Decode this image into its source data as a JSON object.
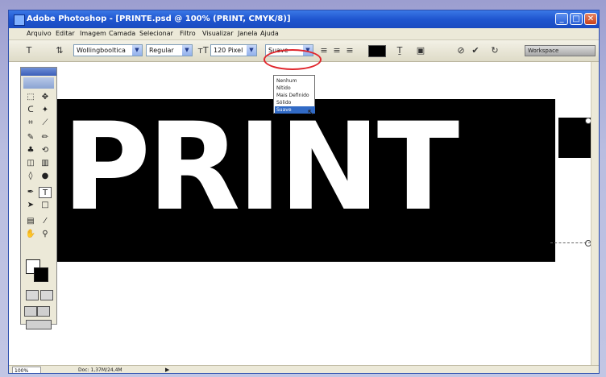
{
  "window": {
    "title": "Adobe Photoshop - [PRINTE.psd @ 100% (PRINT, CMYK/8)]",
    "minimize_glyph": "_",
    "maximize_glyph": "□",
    "close_glyph": "✕"
  },
  "menubar": {
    "items": [
      "Arquivo",
      "Editar",
      "Imagem",
      "Camada",
      "Selecionar",
      "Filtro",
      "Visualizar",
      "Janela",
      "Ajuda"
    ]
  },
  "options_bar": {
    "font_family": "Wollingbooltica",
    "font_style": "Regular",
    "font_size": "120 Pixel",
    "antialias": "Suave",
    "color_hex": "#000000",
    "workspace": "Workspace"
  },
  "antialias_dropdown": {
    "options": [
      "Nenhum",
      "Nítido",
      "Mais Definido",
      "Sólido",
      "Suave"
    ],
    "selected_index": 4
  },
  "canvas": {
    "text": "PRINT",
    "banner_color": "#000000",
    "text_color": "#ffffff"
  },
  "toolbox": {
    "tools": [
      "marquee-icon",
      "move-icon",
      "lasso-icon",
      "magic-wand-icon",
      "crop-icon",
      "slice-icon",
      "brush-icon",
      "pencil-icon",
      "stamp-icon",
      "history-brush-icon",
      "eraser-icon",
      "gradient-icon",
      "blur-icon",
      "dodge-icon",
      "pen-icon",
      "type-icon",
      "path-select-icon",
      "shape-icon",
      "notes-icon",
      "eyedropper-icon",
      "hand-icon",
      "zoom-icon"
    ]
  },
  "statusbar": {
    "zoom": "100%",
    "doc_info": "Doc: 1,37M/24,4M"
  },
  "accent": {
    "highlight": "#e0262c",
    "selection": "#316ac5",
    "titlebar": "#1f55cf"
  }
}
